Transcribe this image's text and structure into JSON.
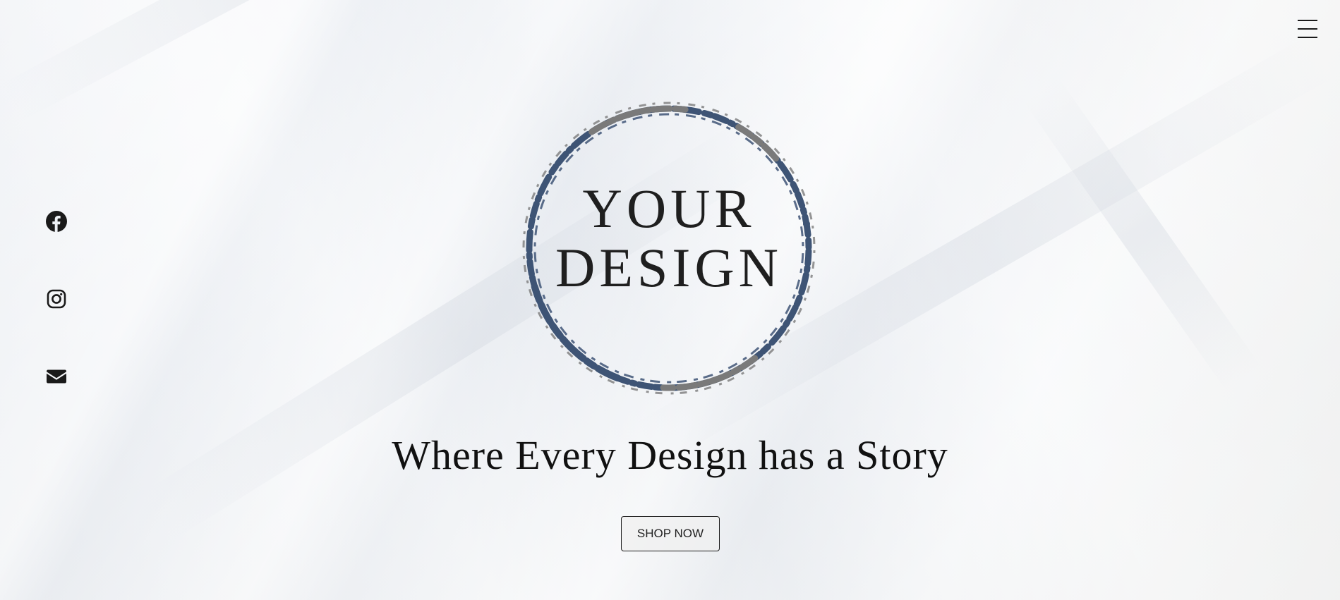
{
  "logo": {
    "line1": "YOUR",
    "line2": "DESIGN"
  },
  "hero": {
    "tagline": "Where Every Design has a Story",
    "cta_label": "SHOP NOW"
  },
  "social": {
    "items": [
      "facebook-icon",
      "instagram-icon",
      "email-icon"
    ]
  },
  "header": {
    "menu_icon": "hamburger-menu-icon"
  },
  "colors": {
    "ornament_blue": "#3e5475",
    "ornament_gray": "#7a7a7a",
    "text": "#1f1f1f"
  }
}
